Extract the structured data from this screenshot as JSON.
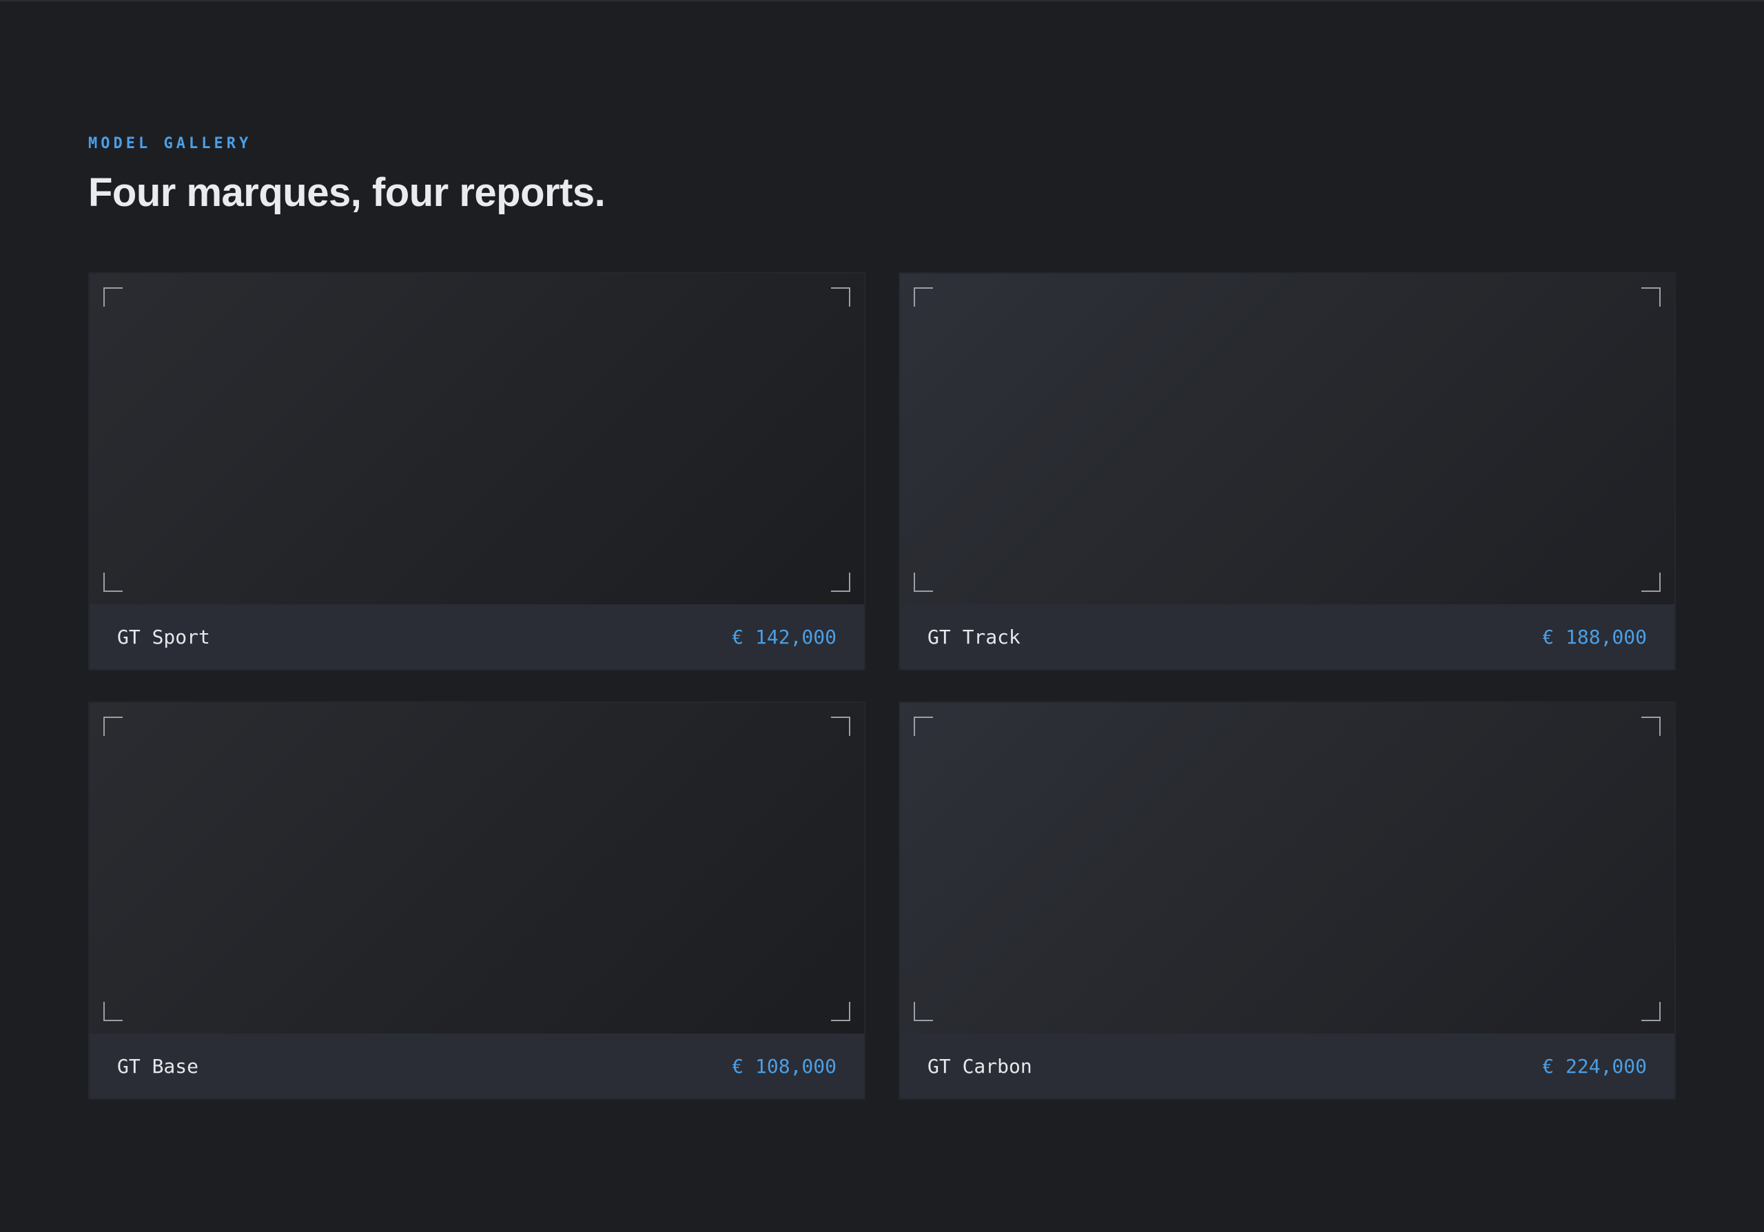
{
  "header": {
    "eyebrow": "MODEL GALLERY",
    "title": "Four marques, four reports."
  },
  "colors": {
    "background": "#1c1e22",
    "accent": "#4b9fe6",
    "card_footer": "#2a2d35",
    "text": "#e9ebee"
  },
  "gallery": {
    "cards": [
      {
        "name": "GT Sport",
        "price": "€ 142,000"
      },
      {
        "name": "GT Track",
        "price": "€ 188,000"
      },
      {
        "name": "GT Base",
        "price": "€ 108,000"
      },
      {
        "name": "GT Carbon",
        "price": "€ 224,000"
      }
    ]
  }
}
